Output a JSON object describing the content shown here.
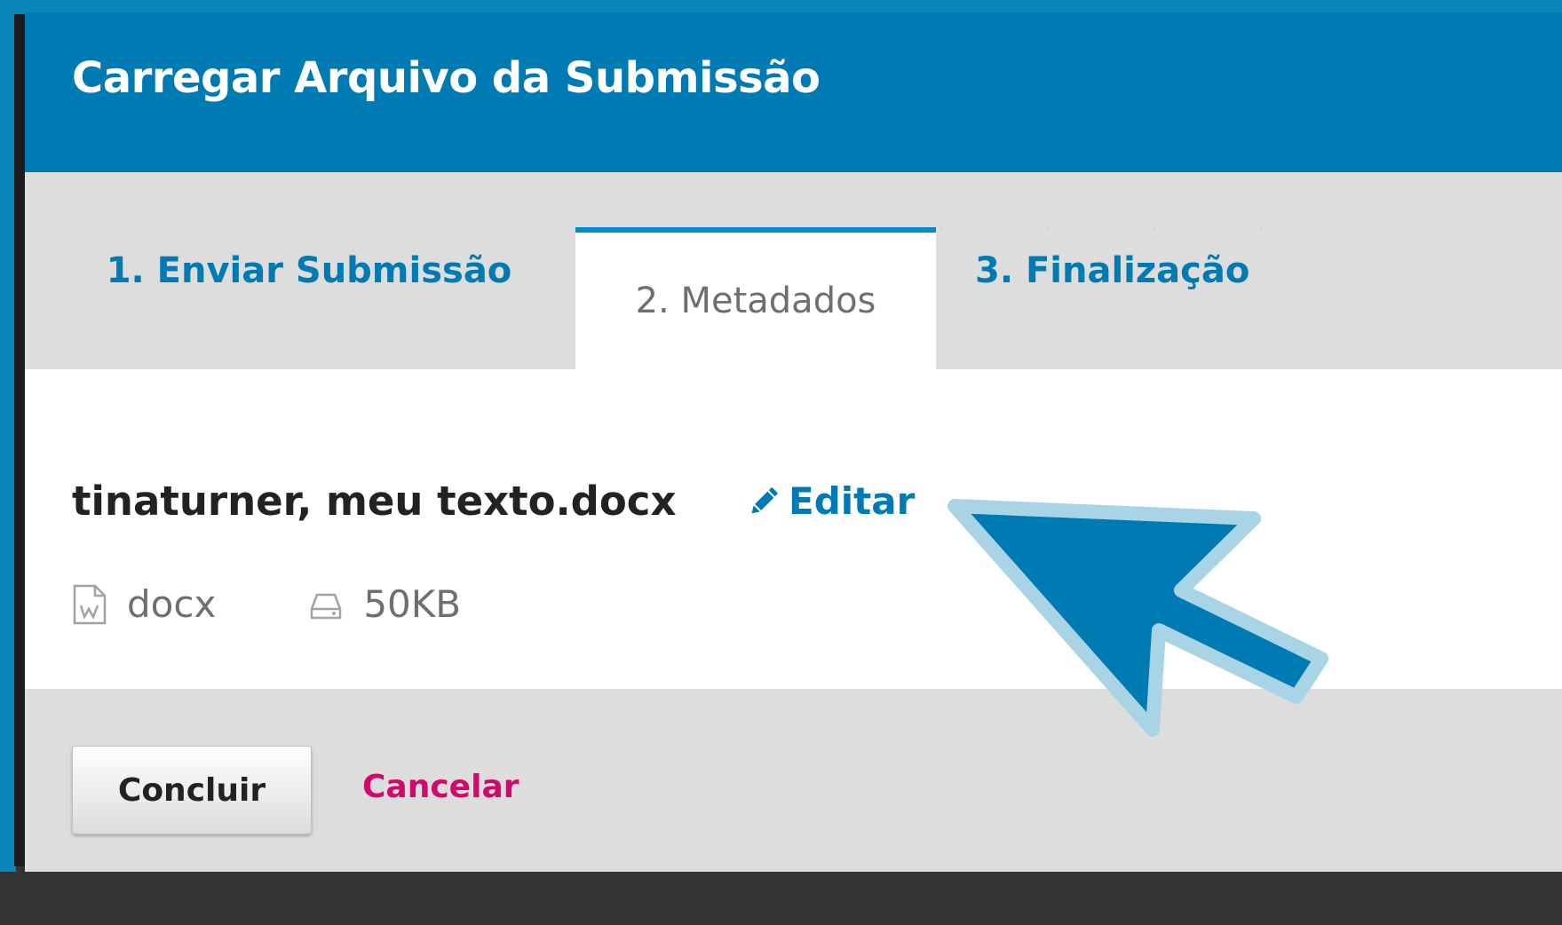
{
  "modal": {
    "title": "Carregar Arquivo da Submissão"
  },
  "tabs": [
    {
      "label": "1. Enviar Submissão",
      "active": false
    },
    {
      "label": "2. Metadados",
      "active": true
    },
    {
      "label": "3. Finalização",
      "active": false
    }
  ],
  "file": {
    "name": "tinaturner, meu texto.docx",
    "edit_label": "Editar",
    "type": "docx",
    "size": "50KB"
  },
  "footer": {
    "submit_label": "Concluir",
    "cancel_label": "Cancelar"
  },
  "colors": {
    "header": "#007ab2",
    "link": "#007ab2",
    "cancel": "#d00a6c",
    "tab_bar": "#dddddd",
    "pointer_fill": "#007ab2",
    "pointer_outline": "#a8d4e6"
  },
  "icons": {
    "edit": "pencil-icon",
    "type": "word-file-icon",
    "size": "hard-drive-icon",
    "annotation": "arrow-pointer-icon"
  }
}
